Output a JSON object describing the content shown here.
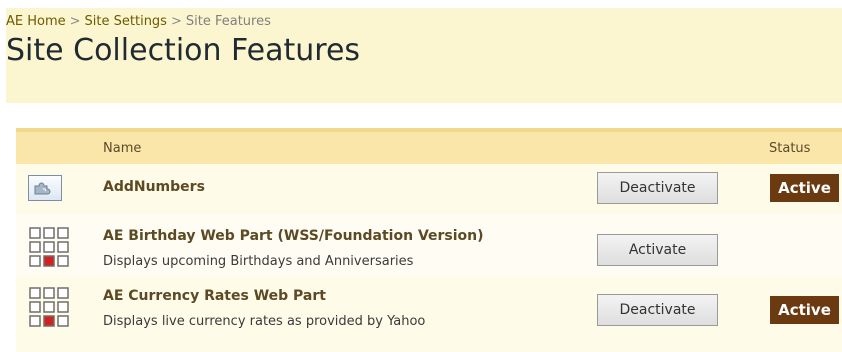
{
  "breadcrumb": {
    "items": [
      "AE Home",
      "Site Settings",
      "Site Features"
    ],
    "separator": ">"
  },
  "page_title": "Site Collection Features",
  "table": {
    "col_name": "Name",
    "col_status": "Status"
  },
  "features": [
    {
      "title": "AddNumbers",
      "description": "",
      "button": "Deactivate",
      "status": "Active",
      "icon": "puzzle-icon"
    },
    {
      "title": "AE Birthday Web Part (WSS/Foundation Version)",
      "description": "Displays upcoming Birthdays and Anniversaries",
      "button": "Activate",
      "status": "",
      "icon": "web-part-grid-icon"
    },
    {
      "title": "AE Currency Rates Web Part",
      "description": "Displays live currency rates as provided by Yahoo",
      "button": "Deactivate",
      "status": "Active",
      "icon": "web-part-grid-icon"
    }
  ],
  "colors": {
    "header_bg": "#fcf6d0",
    "table_header_bg": "#fbe6a9",
    "active_badge": "#6b3a10",
    "grid_accent": "#d62020"
  }
}
